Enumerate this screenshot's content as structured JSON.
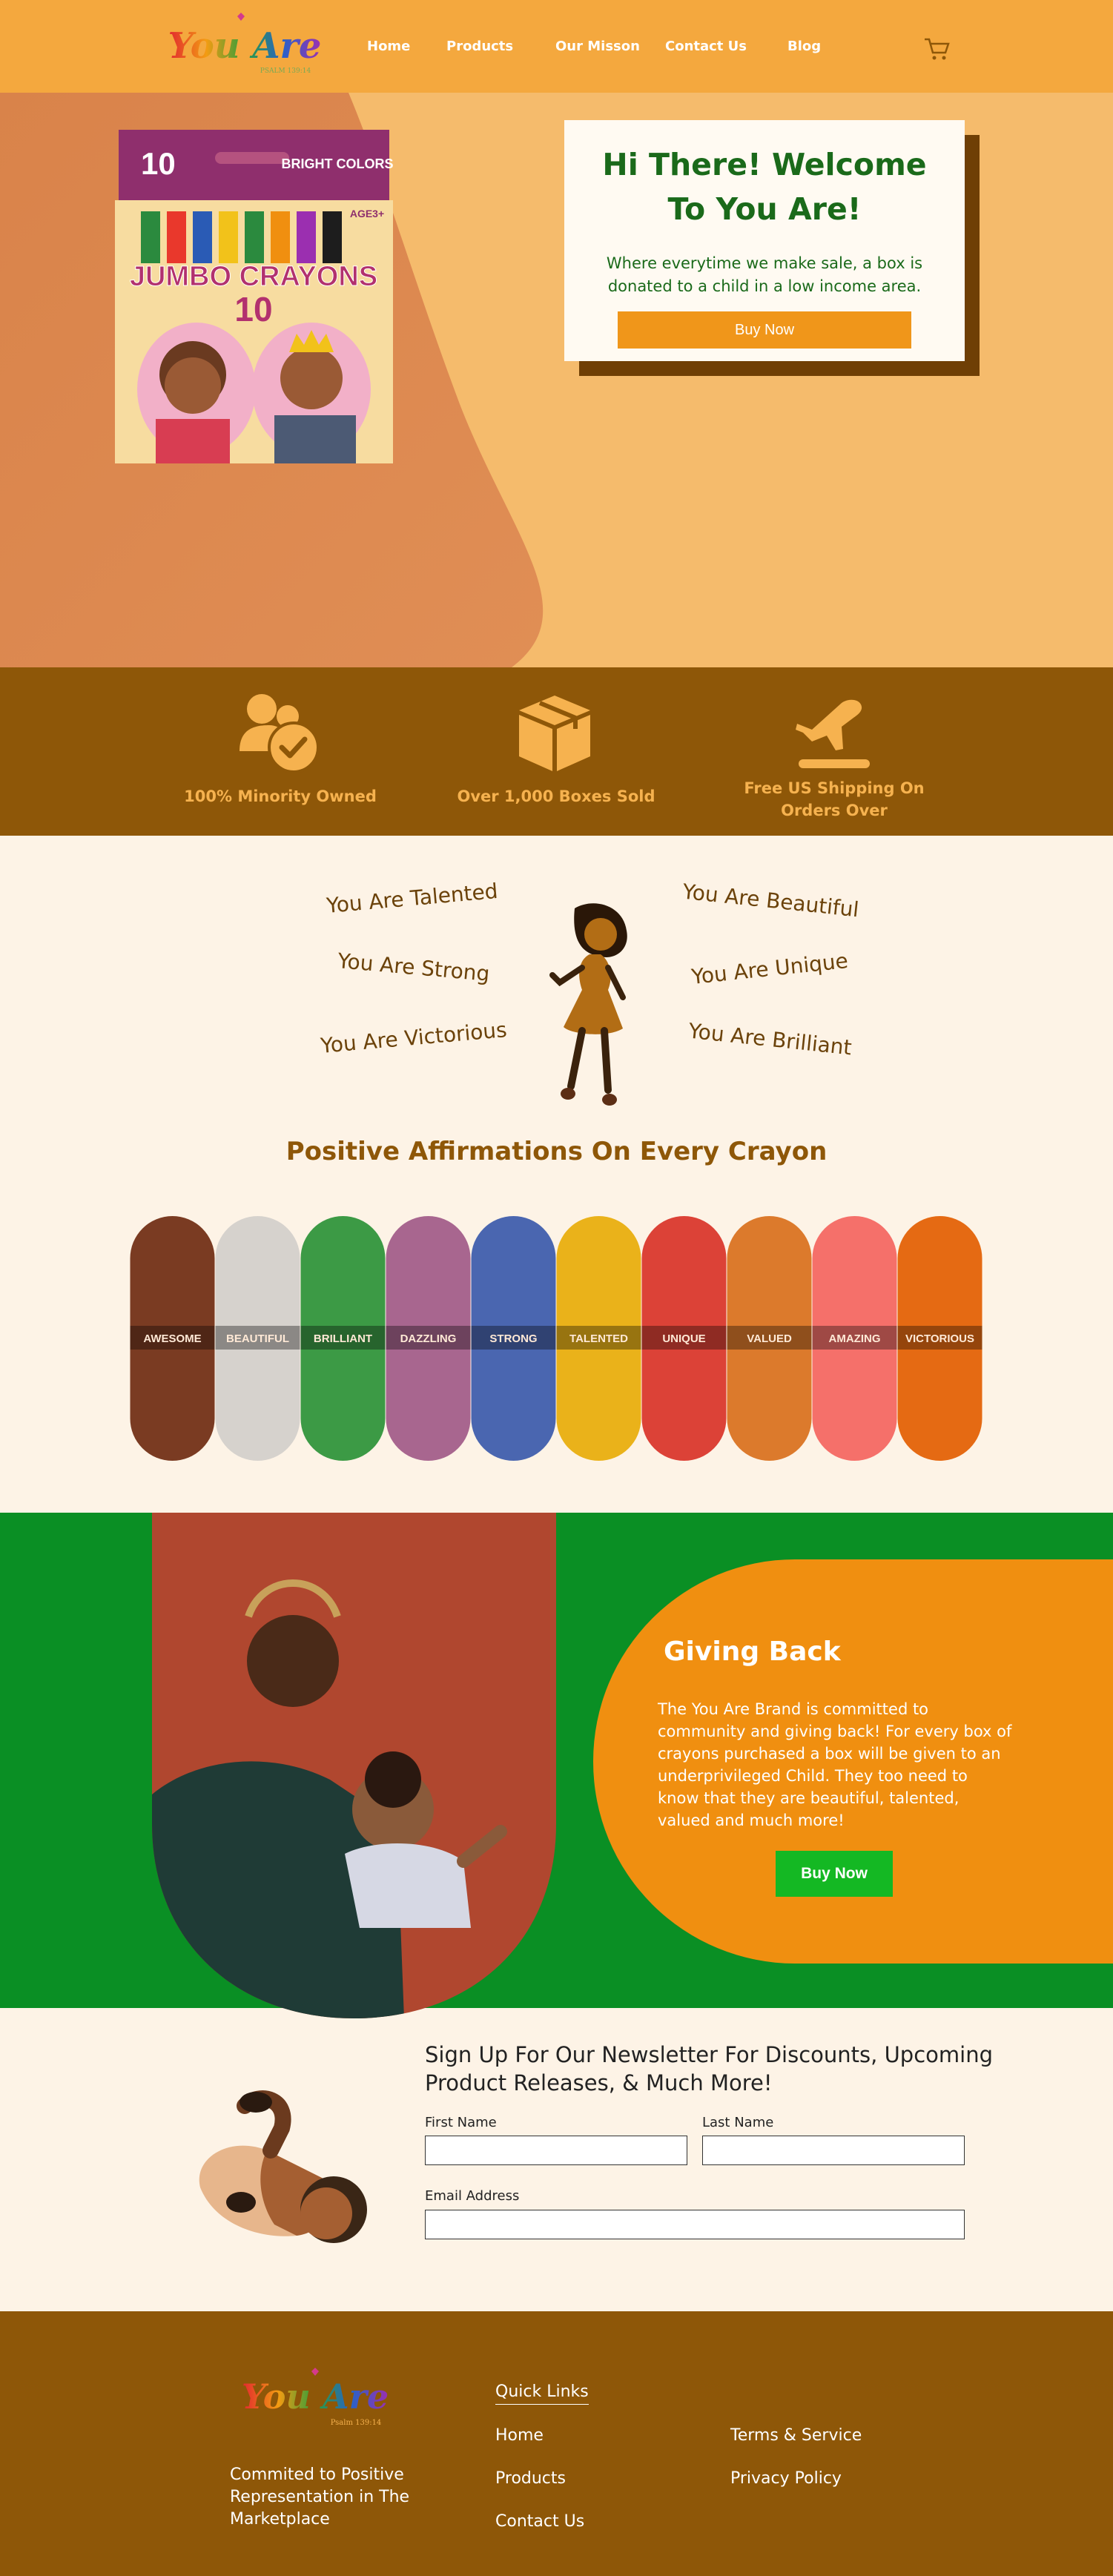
{
  "header": {
    "logo_text": "You Are",
    "logo_sub": "PSALM 139:14",
    "nav": [
      "Home",
      "Products",
      "Our Misson",
      "Contact Us",
      "Blog"
    ]
  },
  "hero": {
    "box_count": "10",
    "box_brand": "BRIGHT COLORS",
    "box_title": "JUMBO CRAYONS",
    "box_age": "AGE3+",
    "title": "Hi There! Welcome To You Are!",
    "text": "Where everytime we make  sale, a box is donated to a child in a low income area.",
    "button": "Buy Now"
  },
  "features": [
    {
      "icon": "users-check-icon",
      "label": "100% Minority Owned"
    },
    {
      "icon": "box-icon",
      "label": "Over 1,000 Boxes Sold"
    },
    {
      "icon": "airplane-icon",
      "label": "Free US Shipping On Orders Over"
    }
  ],
  "affirmations": {
    "left": [
      "You Are Talented",
      "You Are Strong",
      "You Are Victorious"
    ],
    "right": [
      "You Are Beautiful",
      "You Are Unique",
      "You Are Brilliant"
    ],
    "title": "Positive Affirmations On Every Crayon",
    "crayons": [
      {
        "word": "AWESOME",
        "color": "#7a3b22"
      },
      {
        "word": "BEAUTIFUL",
        "color": "#d6d2cd"
      },
      {
        "word": "BRILLIANT",
        "color": "#3c9a45"
      },
      {
        "word": "DAZZLING",
        "color": "#a8668f"
      },
      {
        "word": "STRONG",
        "color": "#4a66b0"
      },
      {
        "word": "TALENTED",
        "color": "#eab21a"
      },
      {
        "word": "UNIQUE",
        "color": "#dc4237"
      },
      {
        "word": "VALUED",
        "color": "#dc7a2c"
      },
      {
        "word": "AMAZING",
        "color": "#f5706a"
      },
      {
        "word": "VICTORIOUS",
        "color": "#e56a13"
      }
    ]
  },
  "giving": {
    "title": "Giving Back",
    "text": "The You Are Brand is committed to community and giving back! For every box of crayons purchased a box will be given to an underprivileged Child. They too need to know that they are beautiful, talented, valued and much more!",
    "button": "Buy Now"
  },
  "newsletter": {
    "title": "Sign Up For Our Newsletter For Discounts, Upcoming Product Releases, & Much More!",
    "first_name": "First Name",
    "last_name": "Last Name",
    "email": "Email Address"
  },
  "footer": {
    "logo_text": "You Are",
    "logo_sub": "Psalm 139:14",
    "tagline": "Commited to Positive Representation in The Marketplace",
    "quick_links_title": "Quick Links",
    "links_col1": [
      "Home",
      "Products",
      "Contact Us"
    ],
    "links_col2": [
      "Terms & Service",
      "Privacy Policy"
    ]
  },
  "colors": {
    "header": "#f4a83e",
    "brown": "#8e5708",
    "green": "#0a8f24",
    "orange": "#f08f10",
    "cream": "#fdf3e6"
  }
}
